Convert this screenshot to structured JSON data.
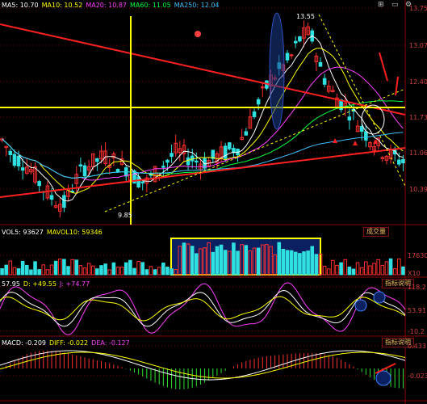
{
  "toolbar": {
    "icons": [
      "grid-icon",
      "restore-icon",
      "chart-settings-icon"
    ]
  },
  "price_panel": {
    "ma_legend": [
      {
        "label": "MA5: 10.70",
        "color": "#ffffff"
      },
      {
        "label": "MA10: 10.52",
        "color": "#ffff00"
      },
      {
        "label": "MA20: 10.87",
        "color": "#ff40ff"
      },
      {
        "label": "MA60: 11.05",
        "color": "#00ff40"
      },
      {
        "label": "MA250: 12.04",
        "color": "#40c0ff"
      }
    ],
    "high_marker": "13.55",
    "low_marker": "9.85",
    "y_ticks": [
      "13.75",
      "13.07",
      "12.40",
      "11.73",
      "11.06",
      "10.39"
    ]
  },
  "volume_panel": {
    "legend": [
      {
        "label": "VOL5: 93627",
        "color": "#ffffff"
      },
      {
        "label": "MAVOL10: 59346",
        "color": "#ffff00"
      }
    ],
    "button": "成交量",
    "y_ticks": [
      "17630",
      "X10"
    ]
  },
  "kdj_panel": {
    "legend": [
      {
        "label": "57.95",
        "color": "#ffffff"
      },
      {
        "label": "D: +49.55",
        "color": "#ffff00"
      },
      {
        "label": "J: +74.77",
        "color": "#ff40ff"
      }
    ],
    "button": "指标说明",
    "y_ticks": [
      "118.2",
      "53.91",
      "-10.2"
    ]
  },
  "macd_panel": {
    "legend": [
      {
        "label": "MACD: -0.209",
        "color": "#ffffff"
      },
      {
        "label": "DIFF: -0.022",
        "color": "#ffff00"
      },
      {
        "label": "DEA: -0.127",
        "color": "#ff40ff"
      }
    ],
    "button": "指标说明",
    "y_ticks": [
      "0.433",
      "-0.023"
    ]
  }
}
